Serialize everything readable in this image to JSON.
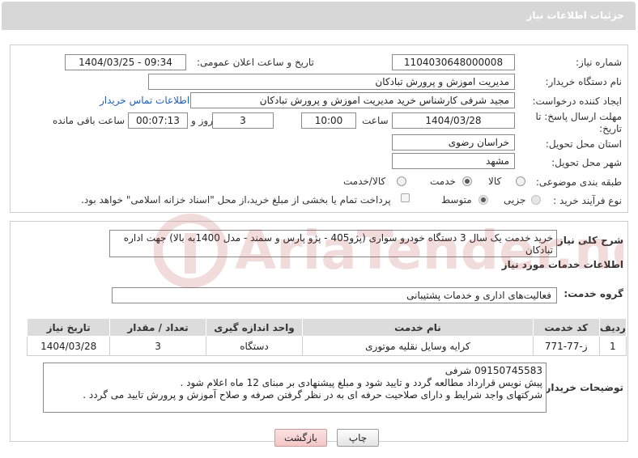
{
  "header": {
    "title": "جزئیات اطلاعات نیاز"
  },
  "need_info": {
    "need_number_label": "شماره نیاز:",
    "need_number": "1104030648000008",
    "announce_label": "تاریخ و ساعت اعلان عمومی:",
    "announce_value": "1404/03/25 - 09:34",
    "buyer_org_label": "نام دستگاه خریدار:",
    "buyer_org": "مدیریت اموزش و پرورش تبادکان",
    "requester_label": "ایجاد کننده درخواست:",
    "requester": "مجید شرفی کارشناس خرید مدیریت اموزش و پرورش تبادکان",
    "contact_link": "اطلاعات تماس خریدار",
    "deadline_label": "مهلت ارسال پاسخ: تا تاریخ:",
    "deadline_date": "1404/03/28",
    "time_label": "ساعت",
    "deadline_time": "10:00",
    "days_value": "3",
    "days_label": "روز و",
    "remaining_value": "00:07:13",
    "remaining_label": "ساعت باقی مانده",
    "province_label": "استان محل تحویل:",
    "province": "خراسان رضوی",
    "city_label": "شهر محل تحویل:",
    "city": "مشهد",
    "category_label": "طبقه بندی موضوعی:",
    "category_options": [
      "کالا",
      "خدمت",
      "کالا/خدمت"
    ],
    "category_selected": "خدمت",
    "process_label": "نوع فرآیند خرید :",
    "process_options": [
      "جزیی",
      "متوسط"
    ],
    "process_selected": "متوسط",
    "payment_note": "پرداخت تمام یا بخشی از مبلغ خرید،از محل \"اسناد خزانه اسلامی\" خواهد بود."
  },
  "description": {
    "label": "شرح کلی نیاز:",
    "text": "خرید خدمت یک سال  3 دستگاه خودرو سواری (پژو405 - پژو پارس و سمند - مدل 1400به بالا) جهت  اداره تبادکان"
  },
  "services": {
    "section_title": "اطلاعات خدمات مورد نیاز",
    "group_label": "گروه خدمت:",
    "group_value": "فعالیت‌های اداری و خدمات پشتیبانی",
    "columns": [
      "ردیف",
      "کد خدمت",
      "نام خدمت",
      "واحد اندازه گیری",
      "تعداد / مقدار",
      "تاریخ نیاز"
    ],
    "rows": [
      [
        "1",
        "ز-77-771",
        "کرایه وسایل نقلیه موتوری",
        "دستگاه",
        "3",
        "1404/03/28"
      ]
    ]
  },
  "buyer_notes": {
    "label": "توضیحات خریدار:",
    "lines": [
      "09150745583 شرفی",
      "پیش نویس قرارداد مطالعه گردد و تایید شود و مبلغ پیشنهادی بر مبنای 12 ماه  اعلام شود .",
      "شرکتهای واجد شرایط و دارای صلاحیت حرفه ای به در نظر گرفتن صرفه و صلاح آموزش و پرورش تایید می گردد ."
    ]
  },
  "actions": {
    "print_label": "چاپ",
    "back_label": "بازگشت"
  },
  "watermark": {
    "text": "AriaTender.net"
  },
  "colors": {
    "header_bg": "#d7d7d7",
    "link": "#1f5fbf",
    "back_btn": "#f3c6c6"
  }
}
